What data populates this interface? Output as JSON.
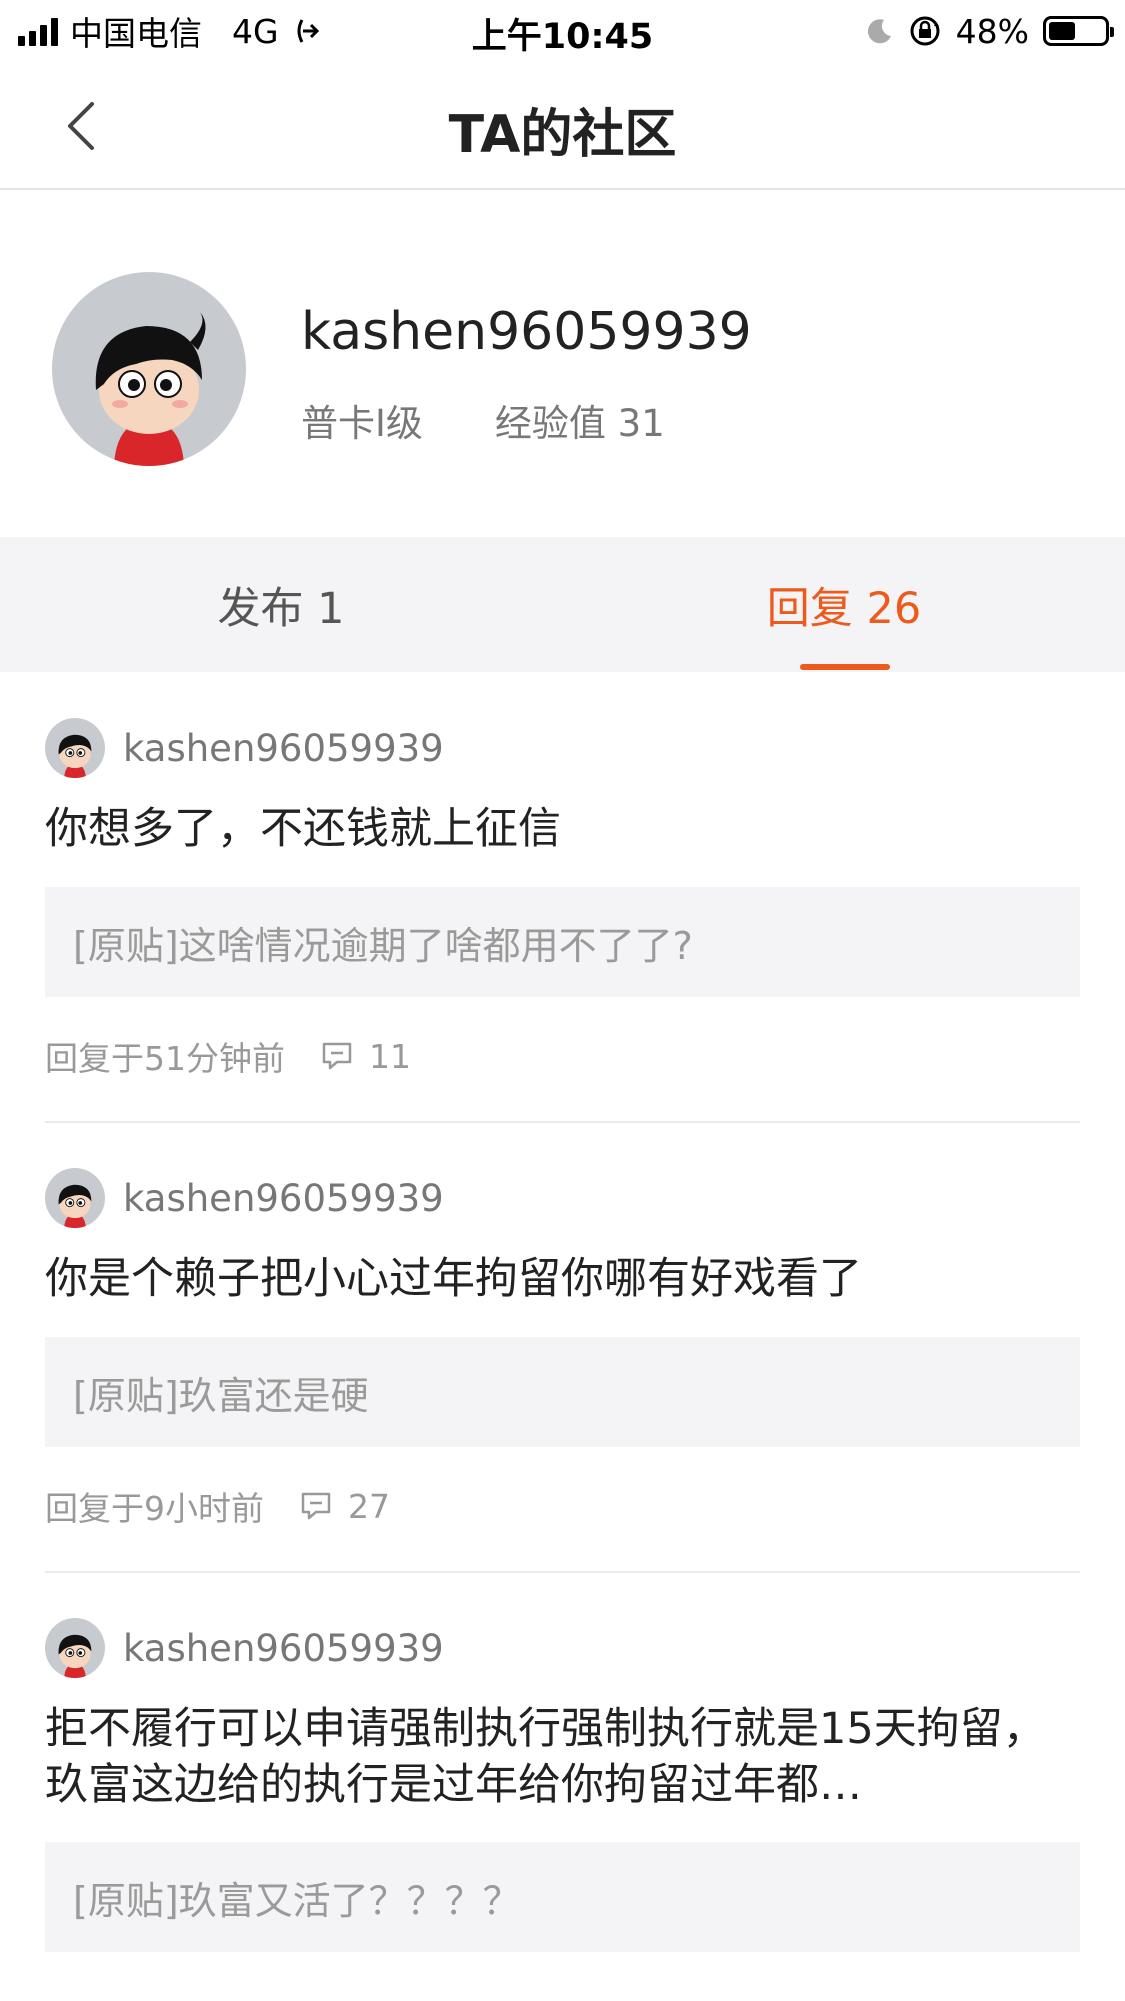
{
  "status_bar": {
    "carrier": "中国电信",
    "network": "4G",
    "time": "上午10:45",
    "battery": "48%",
    "battery_level": 0.48
  },
  "nav": {
    "title": "TA的社区"
  },
  "profile": {
    "username": "kashen96059939",
    "level": "普卡I级",
    "experience": "经验值 31"
  },
  "tabs": [
    {
      "label": "发布 1",
      "active": false
    },
    {
      "label": "回复 26",
      "active": true
    }
  ],
  "replies": [
    {
      "username": "kashen96059939",
      "content": "你想多了，不还钱就上征信",
      "original_post": "[原贴]这啥情况逾期了啥都用不了了?",
      "time": "回复于51分钟前",
      "comments": "11"
    },
    {
      "username": "kashen96059939",
      "content": "你是个赖子把小心过年拘留你哪有好戏看了",
      "original_post": "[原贴]玖富还是硬",
      "time": "回复于9小时前",
      "comments": "27"
    },
    {
      "username": "kashen96059939",
      "content": "拒不履行可以申请强制执行强制执行就是15天拘留，玖富这边给的执行是过年给你拘留过年都…",
      "original_post": "[原贴]玖富又活了？？？？",
      "time": "",
      "comments": ""
    }
  ],
  "colors": {
    "accent": "#ee5a1b",
    "tab_bg": "#f4f4f6",
    "quote_bg": "#f4f4f6"
  }
}
